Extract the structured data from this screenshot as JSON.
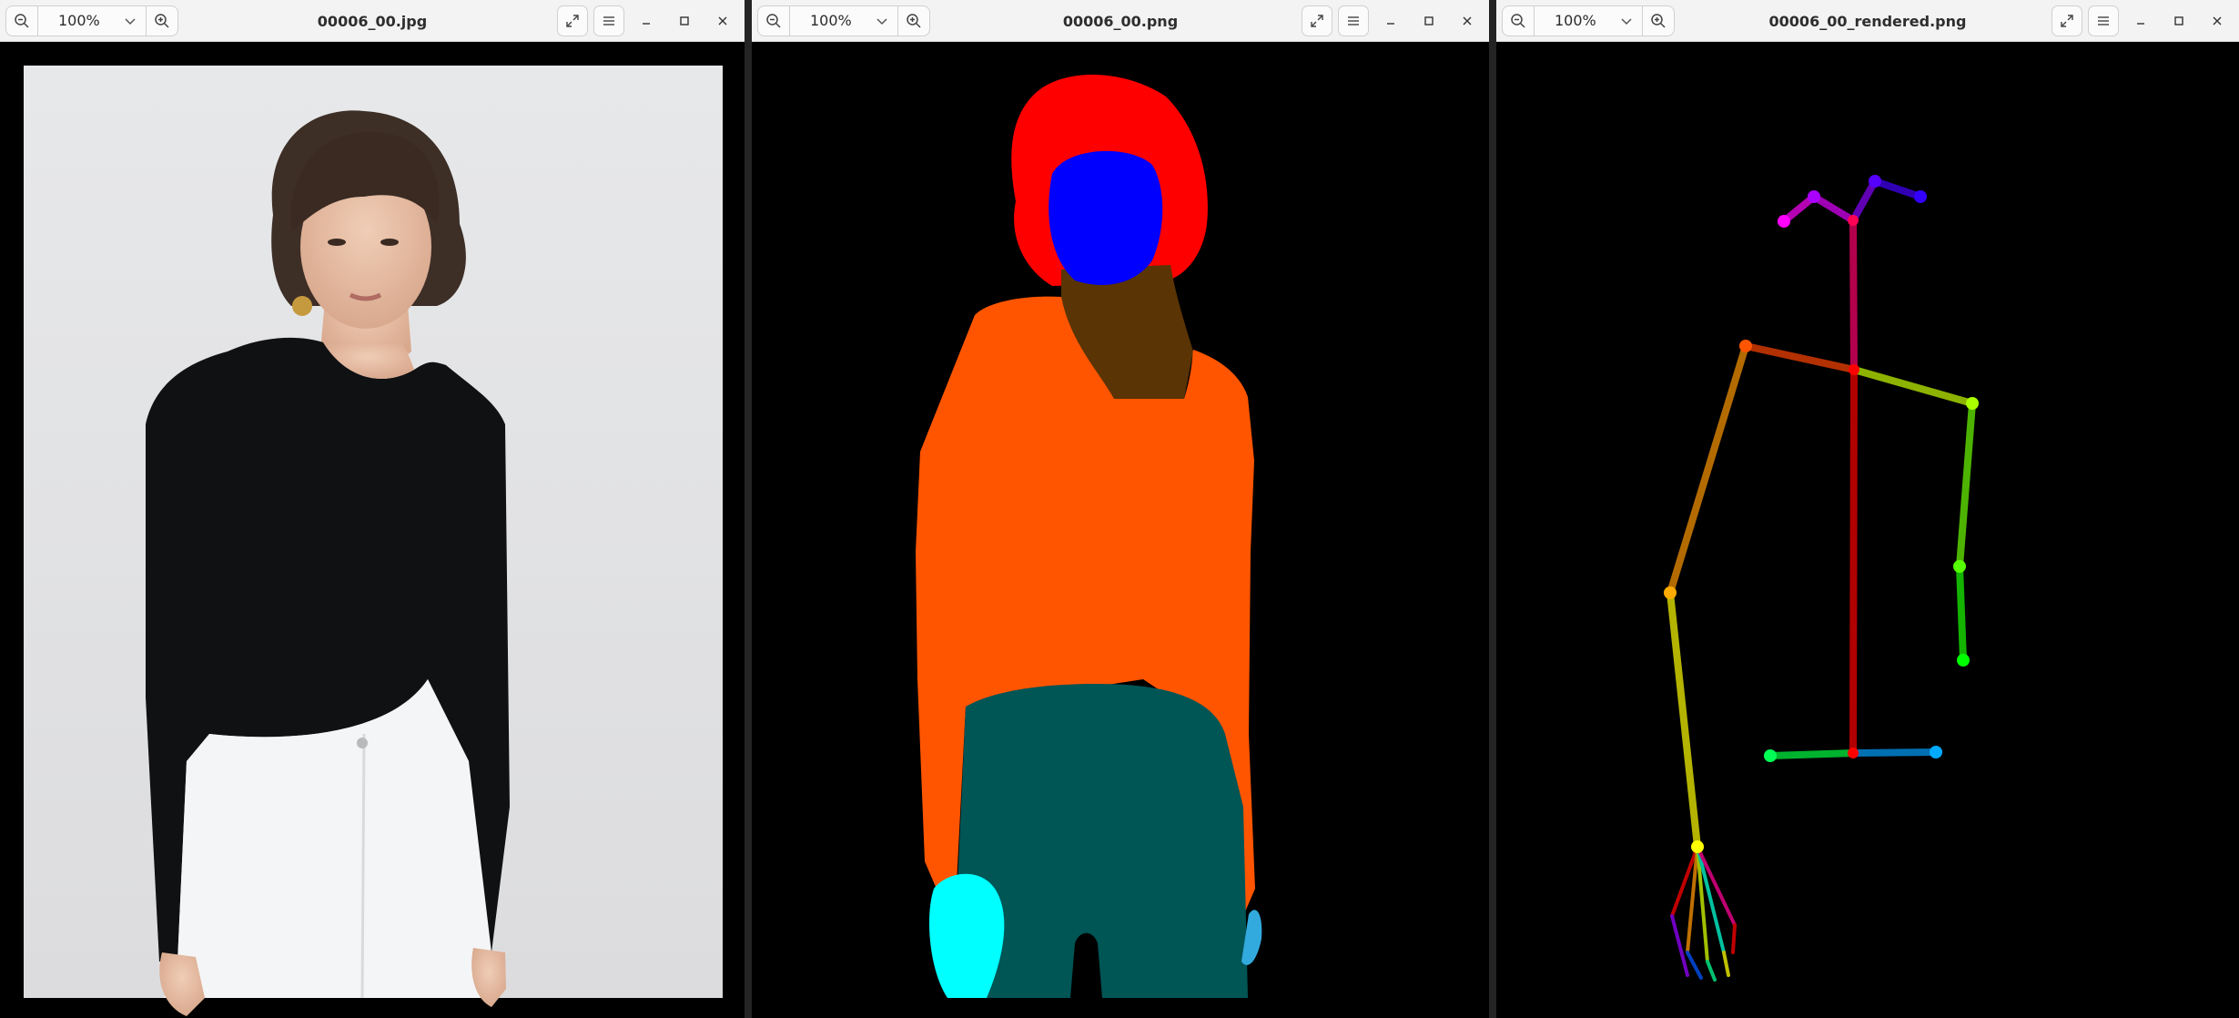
{
  "windows": [
    {
      "id": "photo",
      "title": "00006_00.jpg",
      "zoom": "100%",
      "icons": {
        "zoom_out": "zoom-out-icon",
        "zoom_in": "zoom-in-icon",
        "fullscreen": "fullscreen-icon",
        "menu": "hamburger-menu-icon",
        "minimize": "minimize-icon",
        "maximize": "maximize-icon",
        "close": "close-icon"
      }
    },
    {
      "id": "parse",
      "title": "00006_00.png",
      "zoom": "100%",
      "icons": {
        "zoom_out": "zoom-out-icon",
        "zoom_in": "zoom-in-icon",
        "fullscreen": "fullscreen-icon",
        "menu": "hamburger-menu-icon",
        "minimize": "minimize-icon",
        "maximize": "maximize-icon",
        "close": "close-icon"
      }
    },
    {
      "id": "pose",
      "title": "00006_00_rendered.png",
      "zoom": "100%",
      "icons": {
        "zoom_out": "zoom-out-icon",
        "zoom_in": "zoom-in-icon",
        "fullscreen": "fullscreen-icon",
        "menu": "hamburger-menu-icon",
        "minimize": "minimize-icon",
        "maximize": "maximize-icon",
        "close": "close-icon"
      }
    }
  ],
  "colors": {
    "titlebar_bg": "#f3f3f3",
    "canvas_bg": "#000000",
    "parse_hair": "#ff0000",
    "parse_face": "#0000ff",
    "parse_neck": "#5a3404",
    "parse_top": "#ff5500",
    "parse_pants": "#005555",
    "parse_left_hand": "#00ffff",
    "parse_right_hand": "#33aadd"
  }
}
